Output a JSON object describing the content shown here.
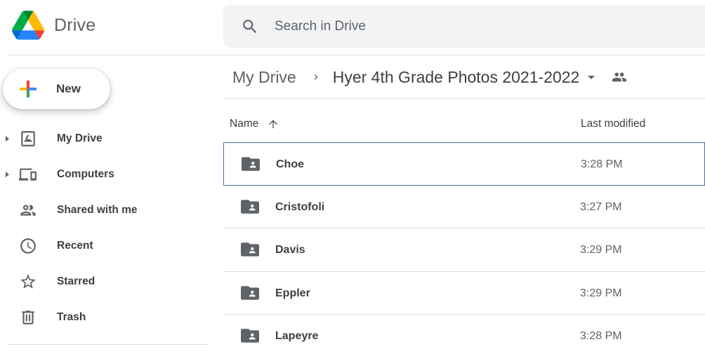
{
  "app": {
    "title": "Drive",
    "logo_icon": "google-drive-logo-icon"
  },
  "search": {
    "placeholder": "Search in Drive",
    "icon": "search-icon"
  },
  "sidebar": {
    "new_button": {
      "label": "New",
      "icon": "plus-multicolor-icon"
    },
    "items": [
      {
        "label": "My Drive",
        "icon": "my-drive-icon",
        "expandable": true
      },
      {
        "label": "Computers",
        "icon": "computers-icon",
        "expandable": true
      },
      {
        "label": "Shared with me",
        "icon": "shared-people-icon",
        "expandable": false
      },
      {
        "label": "Recent",
        "icon": "clock-icon",
        "expandable": false
      },
      {
        "label": "Starred",
        "icon": "star-icon",
        "expandable": false
      },
      {
        "label": "Trash",
        "icon": "trash-icon",
        "expandable": false
      }
    ]
  },
  "breadcrumb": {
    "root": "My Drive",
    "current": "Hyer 4th Grade Photos 2021-2022",
    "shared_icon": "people-icon"
  },
  "columns": {
    "name": "Name",
    "modified": "Last modified",
    "sort_icon": "arrow-up-icon"
  },
  "files": [
    {
      "name": "Choe",
      "modified": "3:28 PM",
      "icon": "shared-folder-icon",
      "selected": true
    },
    {
      "name": "Cristofoli",
      "modified": "3:27 PM",
      "icon": "shared-folder-icon",
      "selected": false
    },
    {
      "name": "Davis",
      "modified": "3:29 PM",
      "icon": "shared-folder-icon",
      "selected": false
    },
    {
      "name": "Eppler",
      "modified": "3:29 PM",
      "icon": "shared-folder-icon",
      "selected": false
    },
    {
      "name": "Lapeyre",
      "modified": "3:28 PM",
      "icon": "shared-folder-icon",
      "selected": false
    }
  ],
  "colors": {
    "drive_green": "#1ea362",
    "drive_yellow": "#ffba00",
    "drive_blue": "#4688f4",
    "icon_gray": "#5f6368",
    "selection_border": "#4a6fa5"
  }
}
